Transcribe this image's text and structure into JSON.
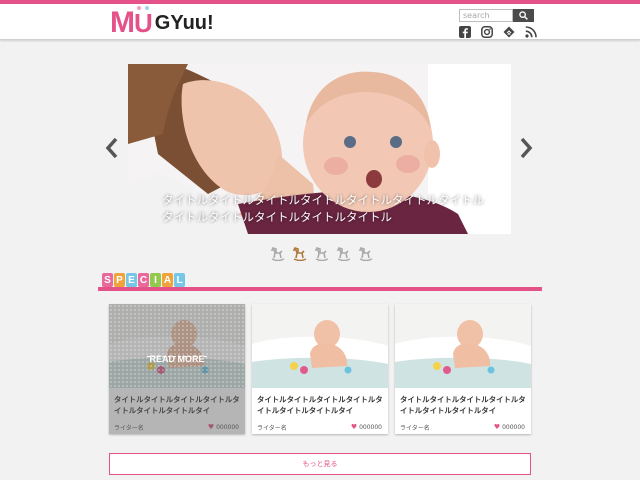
{
  "brand": {
    "logo_m": "M",
    "logo_u": "U",
    "logo_rest": "GYuu!",
    "accent_color": "#e5528a"
  },
  "header": {
    "search": {
      "placeholder": "search"
    },
    "social_icons": [
      "facebook-icon",
      "instagram-icon",
      "feedly-icon",
      "rss-icon"
    ]
  },
  "slider": {
    "caption": "タイトルタイトルタイトルタイトルタイトルタイトルタイトルタイトルタイトルタイトルタイトルタイトル",
    "active_dot": 1,
    "dot_count": 5
  },
  "special": {
    "letters": [
      "S",
      "P",
      "E",
      "C",
      "I",
      "A",
      "L"
    ],
    "letter_colors": [
      "#e76a9a",
      "#f0a33a",
      "#76c6e8",
      "#e76a9a",
      "#93c94f",
      "#f0a33a",
      "#76c6e8"
    ]
  },
  "cards": [
    {
      "title": "タイトルタイトルタイトルタイトルタイトルタイトルタイトルタイ",
      "writer": "ライター名",
      "likes": "000000",
      "hover_label": "READ MORE"
    },
    {
      "title": "タイトルタイトルタイトルタイトルタイトルタイトルタイトルタイ",
      "writer": "ライター名",
      "likes": "000000"
    },
    {
      "title": "タイトルタイトルタイトルタイトルタイトルタイトルタイトルタイ",
      "writer": "ライター名",
      "likes": "000000"
    }
  ],
  "more_button": "もっと見る"
}
